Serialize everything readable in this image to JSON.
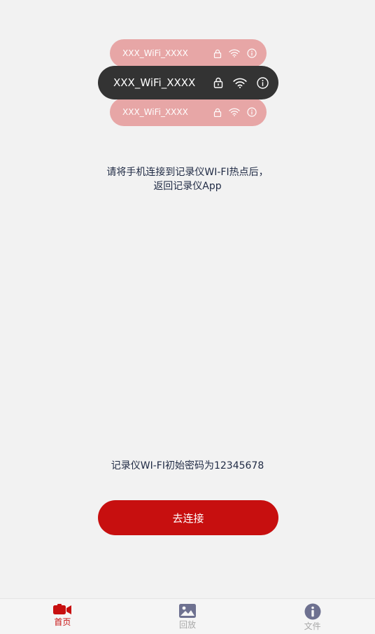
{
  "wifi_list": {
    "top_name": "XXX_WiFi_XXXX",
    "main_name": "XXX_WiFi_XXXX",
    "bottom_name": "XXX_WiFi_XXXX"
  },
  "instruction": {
    "line1": "请将手机连接到记录仪WI-FI热点后，",
    "line2": "返回记录仪App"
  },
  "password_hint": "记录仪WI-FI初始密码为12345678",
  "connect_button_label": "去连接",
  "tabs": [
    {
      "label": "首页",
      "icon": "camera-icon",
      "active": true
    },
    {
      "label": "回放",
      "icon": "image-icon",
      "active": false
    },
    {
      "label": "文件",
      "icon": "info-icon",
      "active": false
    }
  ],
  "colors": {
    "accent": "#c70f0f",
    "faded_pill": "#e7a6a6",
    "dark_pill": "#333333",
    "background": "#f2f2f2",
    "inactive_tab": "#a8a8a8",
    "tab_icon_inactive": "#6e7190"
  }
}
